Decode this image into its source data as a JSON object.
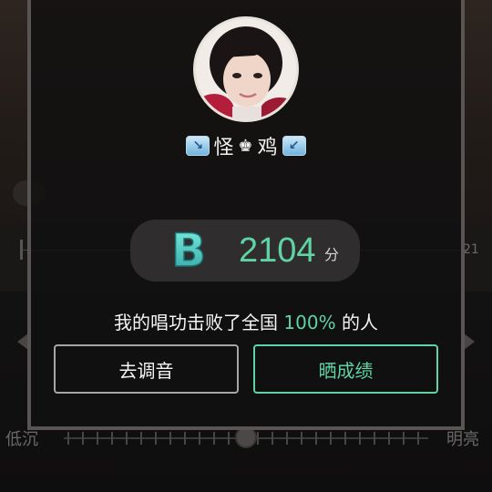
{
  "background": {
    "time_label": "21",
    "left_label": "低沉",
    "right_label": "明亮"
  },
  "modal": {
    "user": {
      "name": "怪",
      "name_deco_left": "↘",
      "name_deco_right": "↙",
      "name_mid_symbol": "♚",
      "name_tail": "鸡"
    },
    "score": {
      "grade": "B",
      "value": "2104",
      "unit": "分"
    },
    "summary": {
      "prefix": "我的唱功击败了全国",
      "percent": "100%",
      "suffix": "的人"
    },
    "buttons": {
      "tune_label": "去调音",
      "share_label": "晒成绩"
    }
  },
  "colors": {
    "accent": "#5fd3a6",
    "modal_border": "#5a5454",
    "pill_bg": "#2f2d2d"
  }
}
